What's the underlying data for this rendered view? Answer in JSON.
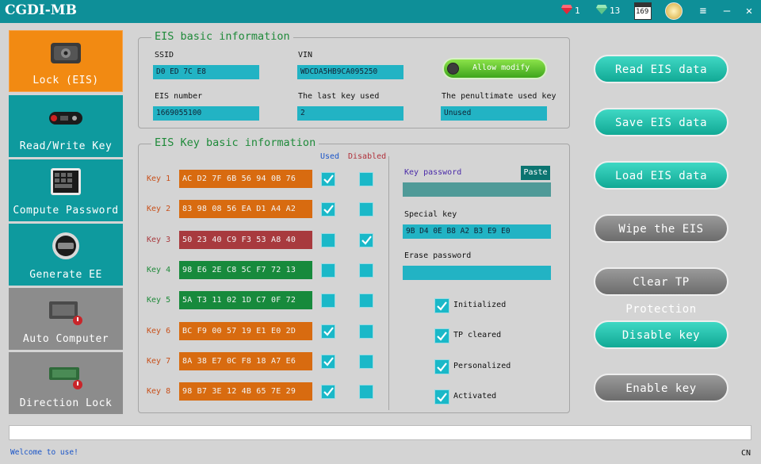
{
  "app": {
    "title": "CGDI-MB",
    "gems_red": "1",
    "gems_green": "13",
    "counter": "169"
  },
  "nav": [
    {
      "label": "Lock (EIS)",
      "active": true
    },
    {
      "label": "Read/Write Key"
    },
    {
      "label": "Compute Password"
    },
    {
      "label": "Generate EE"
    },
    {
      "label": "Auto Computer"
    },
    {
      "label": "Direction Lock"
    }
  ],
  "eis_info": {
    "title": "EIS basic information",
    "ssid_label": "SSID",
    "ssid": "D0 ED 7C E8",
    "vin_label": "VIN",
    "vin": "WDCDA5HB9CA095250",
    "allow_modify": "Allow modify",
    "eis_number_label": "EIS number",
    "eis_number": "1669055100",
    "last_key_label": "The last key used",
    "last_key": "2",
    "penultimate_label": "The penultimate used key",
    "penultimate": "Unused"
  },
  "key_info": {
    "title": "EIS Key basic information",
    "used_header": "Used",
    "disabled_header": "Disabled",
    "keys": [
      {
        "label": "Key 1",
        "value": "AC D2 7F 6B 56 94 0B 76",
        "color": "#d86b10",
        "label_color": "#c8501a",
        "used": true,
        "disabled": false
      },
      {
        "label": "Key 2",
        "value": "83 98 08 56 EA D1 A4 A2",
        "color": "#d86b10",
        "label_color": "#c8501a",
        "used": true,
        "disabled": false
      },
      {
        "label": "Key 3",
        "value": "50 23 40 C9 F3 53 A8 40",
        "color": "#a83a3e",
        "label_color": "#a83a3e",
        "used": false,
        "disabled": true
      },
      {
        "label": "Key 4",
        "value": "98 E6 2E C8 5C F7 72 13",
        "color": "#178a3c",
        "label_color": "#1f8a3a",
        "used": false,
        "disabled": false
      },
      {
        "label": "Key 5",
        "value": "5A T3 11 02 1D C7 0F 72",
        "color": "#178a3c",
        "label_color": "#1f8a3a",
        "used": false,
        "disabled": false
      },
      {
        "label": "Key 6",
        "value": "BC F9 00 57 19 E1 E0 2D",
        "color": "#d86b10",
        "label_color": "#c8501a",
        "used": true,
        "disabled": false
      },
      {
        "label": "Key 7",
        "value": "8A 38 E7 0C F8 18 A7 E6",
        "color": "#d86b10",
        "label_color": "#c8501a",
        "used": true,
        "disabled": false
      },
      {
        "label": "Key 8",
        "value": "98 B7 3E 12 4B 65 7E 29",
        "color": "#d86b10",
        "label_color": "#c8501a",
        "used": true,
        "disabled": false
      }
    ],
    "key_password_label": "Key password",
    "key_password": "",
    "paste": "Paste",
    "special_key_label": "Special key",
    "special_key": "9B D4 0E B8 A2 B3 E9 E0",
    "erase_password_label": "Erase password",
    "erase_password": "",
    "flags": [
      {
        "label": "Initialized",
        "checked": true
      },
      {
        "label": "TP cleared",
        "checked": true
      },
      {
        "label": "Personalized",
        "checked": true
      },
      {
        "label": "Activated",
        "checked": true
      }
    ]
  },
  "actions": [
    {
      "label": "Read  EIS data",
      "style": "teal"
    },
    {
      "label": "Save EIS data",
      "style": "teal"
    },
    {
      "label": "Load EIS data",
      "style": "teal"
    },
    {
      "label": "Wipe the EIS",
      "style": "gray"
    },
    {
      "label": "Clear TP Protection",
      "style": "gray"
    },
    {
      "label": "Disable key",
      "style": "teal"
    },
    {
      "label": "Enable key",
      "style": "gray"
    }
  ],
  "status": {
    "welcome": "Welcome  to  use!",
    "lang": "CN"
  },
  "colors": {
    "titlebar": "#0e8f98",
    "nav_active": "#f28a12",
    "nav_inactive": "#0e9a9e",
    "nav_disabled": "#8c8c8c",
    "field": "#22b3c4"
  }
}
